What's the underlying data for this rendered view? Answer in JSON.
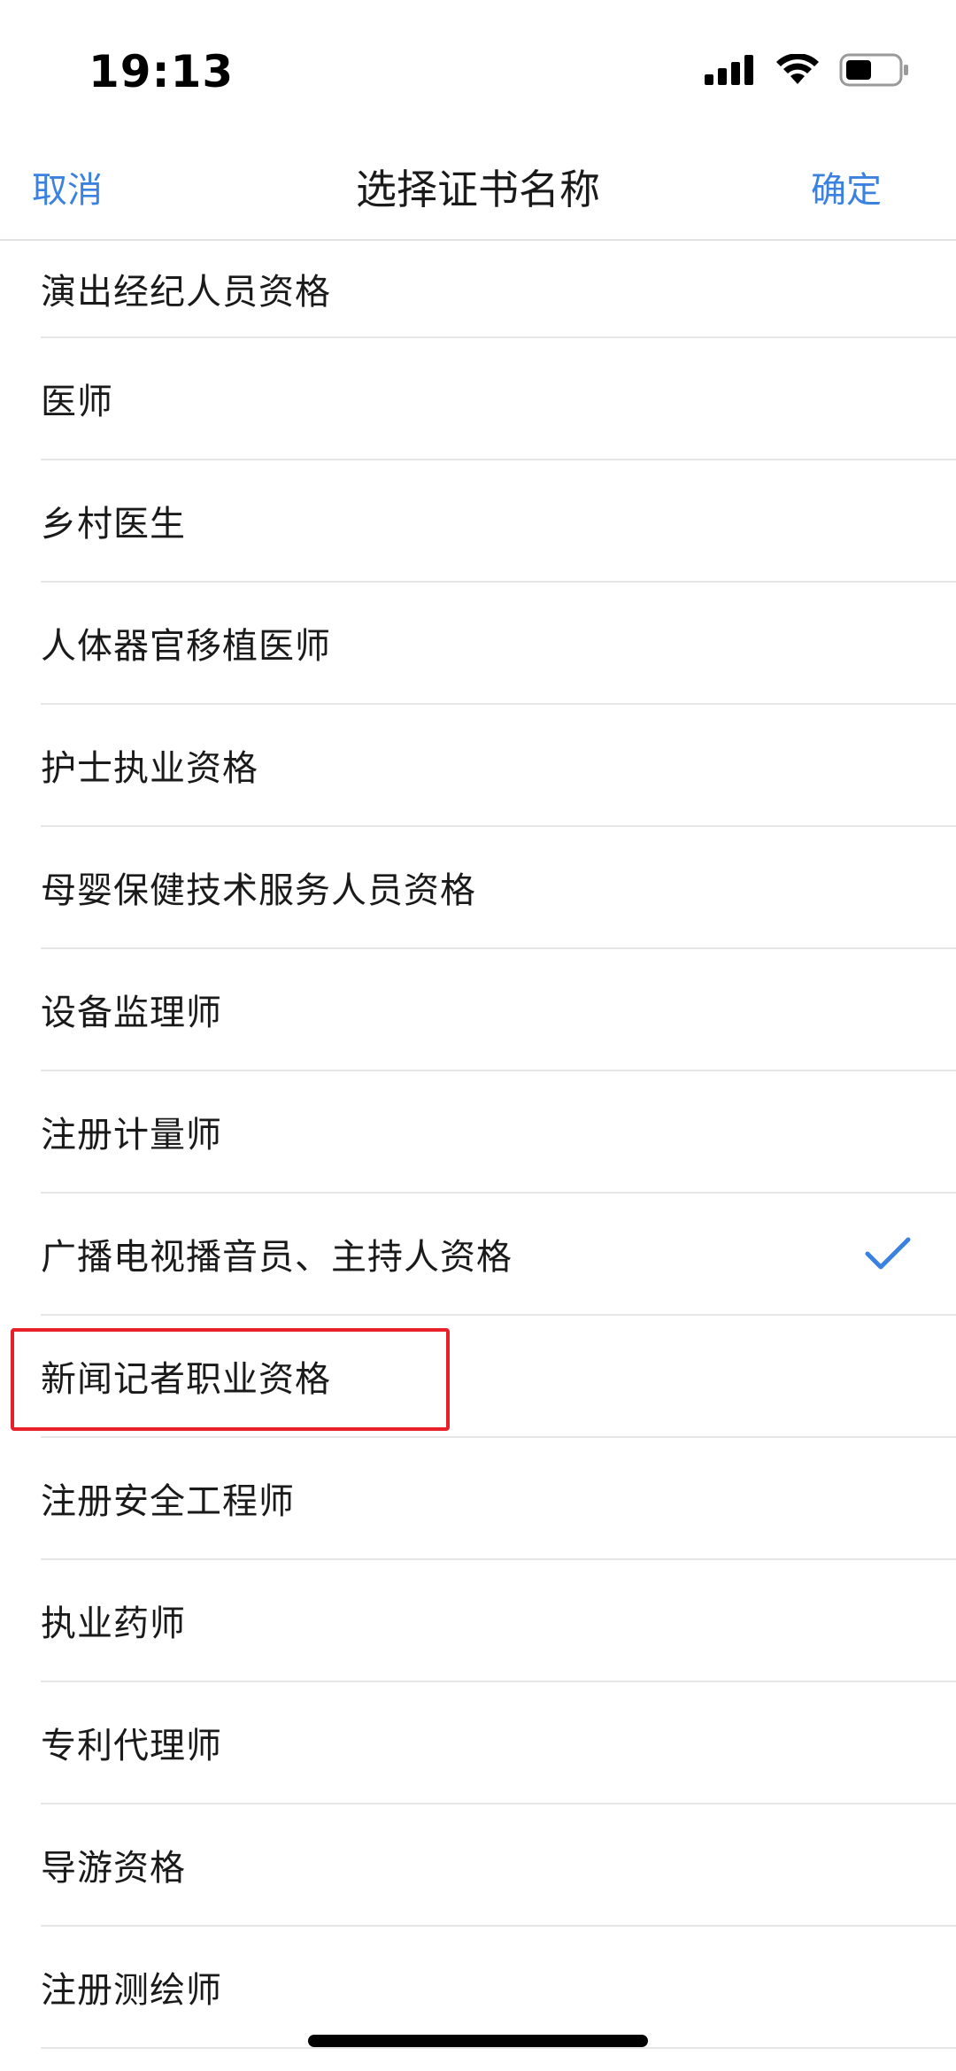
{
  "status_bar": {
    "time": "19:13",
    "icons": [
      "signal-icon",
      "wifi-icon",
      "battery-icon"
    ]
  },
  "nav": {
    "cancel_label": "取消",
    "title": "选择证书名称",
    "confirm_label": "确定"
  },
  "colors": {
    "accent": "#3b82e0",
    "highlight": "#e8202a"
  },
  "list": {
    "items": [
      {
        "label": "演出经纪人员资格",
        "selected": false
      },
      {
        "label": "医师",
        "selected": false
      },
      {
        "label": "乡村医生",
        "selected": false
      },
      {
        "label": "人体器官移植医师",
        "selected": false
      },
      {
        "label": "护士执业资格",
        "selected": false
      },
      {
        "label": "母婴保健技术服务人员资格",
        "selected": false
      },
      {
        "label": "设备监理师",
        "selected": false
      },
      {
        "label": "注册计量师",
        "selected": false
      },
      {
        "label": "广播电视播音员、主持人资格",
        "selected": true
      },
      {
        "label": "新闻记者职业资格",
        "selected": false,
        "highlighted": true
      },
      {
        "label": "注册安全工程师",
        "selected": false
      },
      {
        "label": "执业药师",
        "selected": false
      },
      {
        "label": "专利代理师",
        "selected": false
      },
      {
        "label": "导游资格",
        "selected": false
      },
      {
        "label": "注册测绘师",
        "selected": false
      }
    ]
  }
}
